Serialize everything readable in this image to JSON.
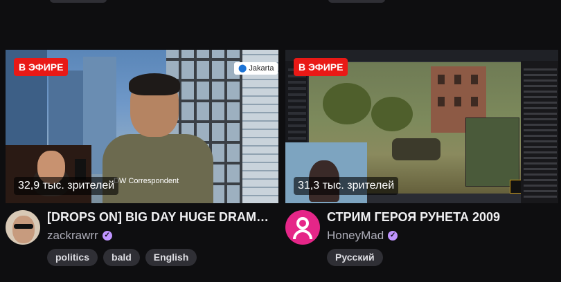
{
  "colors": {
    "background": "#0e0e10",
    "live": "#e91916",
    "verified": "#bf94ff",
    "tag_bg": "#2f2f35"
  },
  "cards": [
    {
      "live_label": "В ЭФИРЕ",
      "viewers": "32,9 тыс. зрителей",
      "thumbnail_overlay": {
        "location": "Jakarta",
        "caption": "DW Correspondent"
      },
      "title": "[DROPS ON] BIG DAY HUGE DRAMA ...",
      "channel": "zackrawrr",
      "verified_icon": "check-icon",
      "tags": [
        "politics",
        "bald",
        "English"
      ]
    },
    {
      "live_label": "В ЭФИРЕ",
      "viewers": "31,3 тыс. зрителей",
      "title": "СТРИМ ГЕРОЯ РУНЕТА 2009",
      "channel": "HoneyMad",
      "verified_icon": "check-icon",
      "tags": [
        "Русский"
      ]
    }
  ]
}
